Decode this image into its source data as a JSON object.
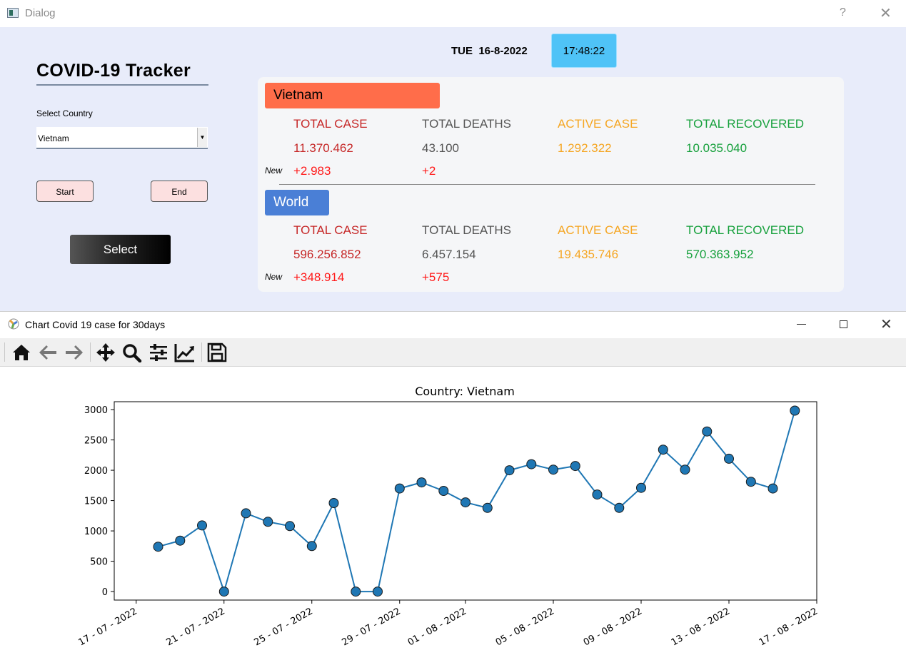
{
  "dialog": {
    "window_title": "Dialog",
    "help_label": "?",
    "close_label": "✕",
    "app_title": "COVID-19  Tracker",
    "select_country_label": "Select Country",
    "selected_country": "Vietnam",
    "start_label": "Start",
    "end_label": "End",
    "select_label": "Select",
    "date": "TUE  16-8-2022",
    "time": "17:48:22",
    "new_label": "New",
    "headers": {
      "total_case": "TOTAL CASE",
      "total_deaths": "TOTAL DEATHS",
      "active_case": "ACTIVE CASE",
      "total_recovered": "TOTAL RECOVERED"
    },
    "vietnam": {
      "name": "Vietnam",
      "total_case": "11.370.462",
      "total_deaths": "43.100",
      "active_case": "1.292.322",
      "total_recovered": "10.035.040",
      "new_case": "+2.983",
      "new_deaths": "+2"
    },
    "world": {
      "name": "World",
      "total_case": "596.256.852",
      "total_deaths": "6.457.154",
      "active_case": "19.435.746",
      "total_recovered": "570.363.952",
      "new_case": "+348.914",
      "new_deaths": "+575"
    }
  },
  "chart_window": {
    "title": "Chart Covid 19 case for 30days",
    "toolbar": [
      "home-icon",
      "back-icon",
      "forward-icon",
      "pan-icon",
      "zoom-icon",
      "subplots-icon",
      "edit-axis-icon",
      "save-icon"
    ]
  },
  "colors": {
    "line": "#1f77b4",
    "vietnam_tag": "#ff6d4a",
    "world_tag": "#4a7fd6",
    "clock": "#4fc3f7"
  },
  "chart_data": {
    "type": "line",
    "title": "Country: Vietnam",
    "xlabel": "",
    "ylabel": "",
    "x_ticks": [
      "17 - 07 - 2022",
      "21 - 07 - 2022",
      "25 - 07 - 2022",
      "29 - 07 - 2022",
      "01 - 08 - 2022",
      "05 - 08 - 2022",
      "09 - 08 - 2022",
      "13 - 08 - 2022",
      "17 - 08 - 2022"
    ],
    "y_ticks": [
      0,
      500,
      1000,
      1500,
      2000,
      2500,
      3000
    ],
    "ylim": [
      -140,
      3130
    ],
    "xlim": [
      "2022-07-16",
      "2022-08-17"
    ],
    "grid": false,
    "markers": true,
    "series": [
      {
        "x": [
          "2022-07-18",
          "2022-07-19",
          "2022-07-20",
          "2022-07-21",
          "2022-07-22",
          "2022-07-23",
          "2022-07-24",
          "2022-07-25",
          "2022-07-26",
          "2022-07-27",
          "2022-07-28",
          "2022-07-29",
          "2022-07-30",
          "2022-07-31",
          "2022-08-01",
          "2022-08-02",
          "2022-08-03",
          "2022-08-04",
          "2022-08-05",
          "2022-08-06",
          "2022-08-07",
          "2022-08-08",
          "2022-08-09",
          "2022-08-10",
          "2022-08-11",
          "2022-08-12",
          "2022-08-13",
          "2022-08-14",
          "2022-08-15",
          "2022-08-16"
        ],
        "y": [
          740,
          840,
          1090,
          0,
          1290,
          1150,
          1080,
          750,
          1460,
          0,
          0,
          1700,
          1800,
          1660,
          1470,
          1380,
          2000,
          2100,
          2010,
          2070,
          1600,
          1380,
          1710,
          2340,
          2010,
          2640,
          2190,
          1810,
          1700,
          2983
        ]
      }
    ]
  }
}
